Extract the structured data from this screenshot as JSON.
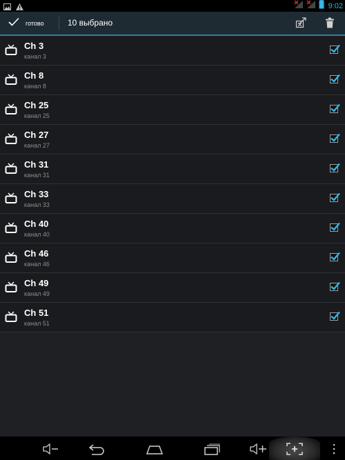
{
  "status_bar": {
    "time": "9:02",
    "icons": [
      "image-notification-icon",
      "warning-icon",
      "no-signal-icon",
      "signal-icon",
      "battery-icon"
    ]
  },
  "action_bar": {
    "done_label": "готово",
    "title": "10 выбрано",
    "actions": [
      "edit-selection-icon",
      "trash-icon"
    ],
    "accent_color": "#2d7ea6"
  },
  "channels": [
    {
      "name": "Ch 3",
      "subtitle": "канал 3",
      "checked": true
    },
    {
      "name": "Ch 8",
      "subtitle": "канал 8",
      "checked": true
    },
    {
      "name": "Ch 25",
      "subtitle": "канал 25",
      "checked": true
    },
    {
      "name": "Ch 27",
      "subtitle": "канал 27",
      "checked": true
    },
    {
      "name": "Ch 31",
      "subtitle": "канал 31",
      "checked": true
    },
    {
      "name": "Ch 33",
      "subtitle": "канал 33",
      "checked": true
    },
    {
      "name": "Ch 40",
      "subtitle": "канал 40",
      "checked": true
    },
    {
      "name": "Ch 46",
      "subtitle": "канал 46",
      "checked": true
    },
    {
      "name": "Ch 49",
      "subtitle": "канал 49",
      "checked": true
    },
    {
      "name": "Ch 51",
      "subtitle": "канал 51",
      "checked": true
    }
  ],
  "nav_bar": {
    "buttons": [
      "volume-down-icon",
      "back-icon",
      "home-icon",
      "recent-apps-icon",
      "volume-up-icon",
      "screenshot-icon",
      "menu-icon"
    ]
  }
}
